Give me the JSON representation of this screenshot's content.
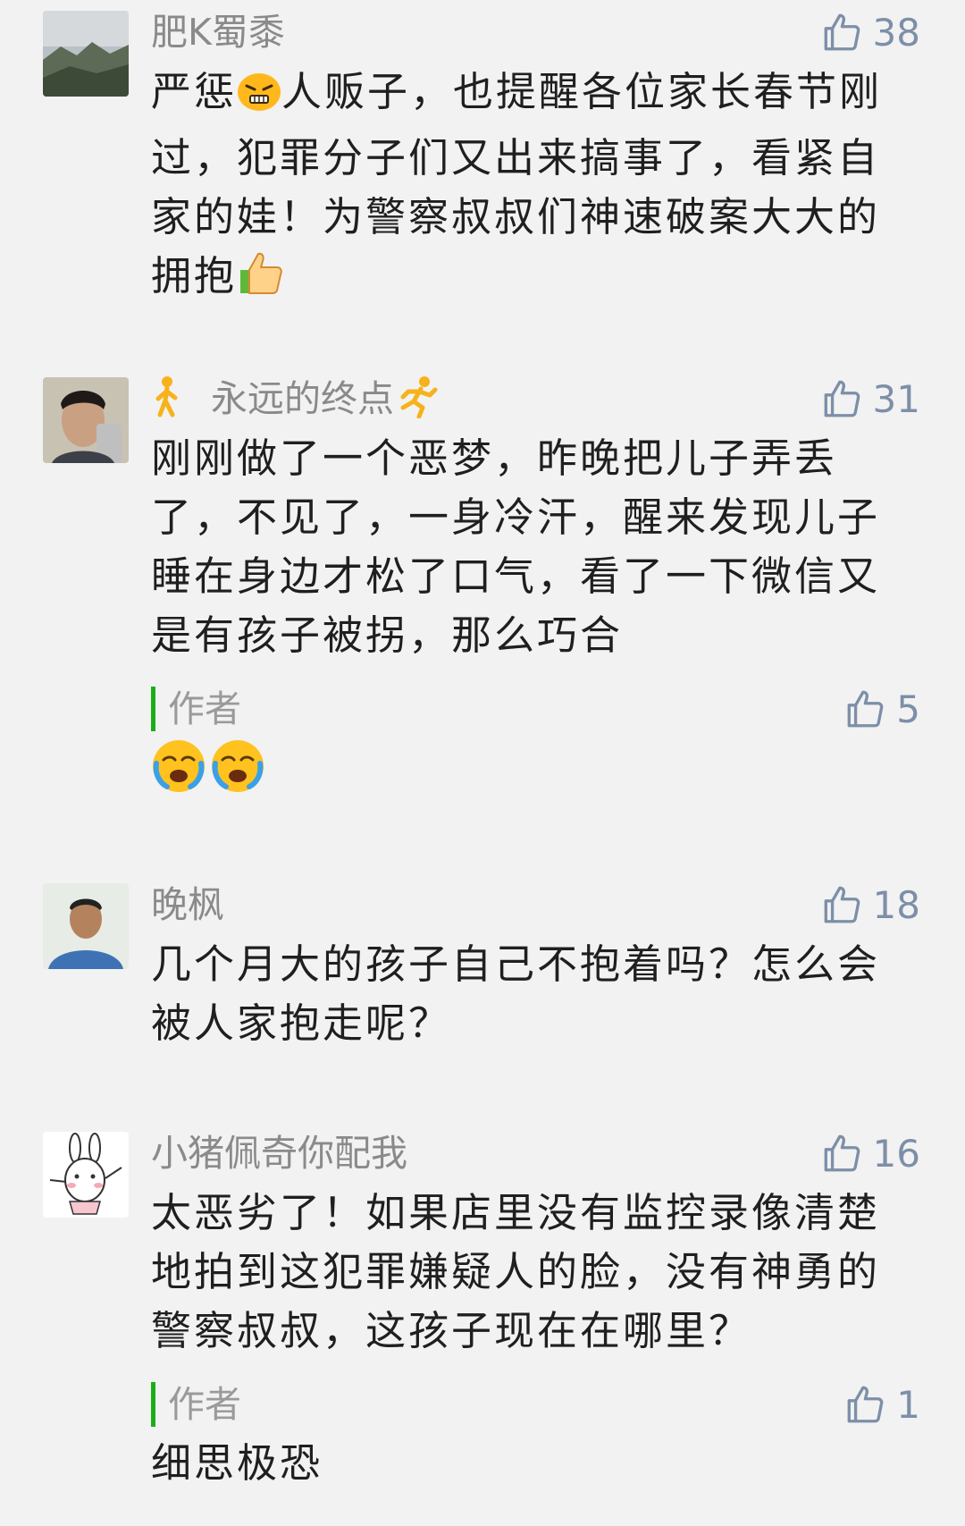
{
  "comments": [
    {
      "username": "肥K蜀黍",
      "likes": "38",
      "text_before_emoji": "严惩",
      "text_after_emoji": "人贩子，也提醒各位家长春节刚过，犯罪分子们又出来搞事了，看紧自家的娃！为警察叔叔们神速破案大大的拥抱",
      "inline_emojis": [
        "angry-face-icon",
        "thumbs-up-icon"
      ]
    },
    {
      "username": "永远的终点",
      "likes": "31",
      "text": "刚刚做了一个恶梦，昨晚把儿子弄丢了，不见了，一身冷汗，醒来发现儿子睡在身边才松了口气，看了一下微信又是有孩子被拐，那么巧合",
      "reply": {
        "label": "作者",
        "likes": "5",
        "emojis": [
          "crying-face-icon",
          "crying-face-icon"
        ]
      }
    },
    {
      "username": "晚枫",
      "likes": "18",
      "text": "几个月大的孩子自己不抱着吗？怎么会被人家抱走呢？"
    },
    {
      "username": "小猪佩奇你配我",
      "likes": "16",
      "text": "太恶劣了！如果店里没有监控录像清楚地拍到这犯罪嫌疑人的脸，没有神勇的警察叔叔，这孩子现在在哪里？",
      "reply": {
        "label": "作者",
        "likes": "1",
        "text": "细思极恐"
      }
    }
  ],
  "colors": {
    "background": "#f2f2f2",
    "author_bar": "#1aad19",
    "like_icon": "#7d8fa8"
  }
}
